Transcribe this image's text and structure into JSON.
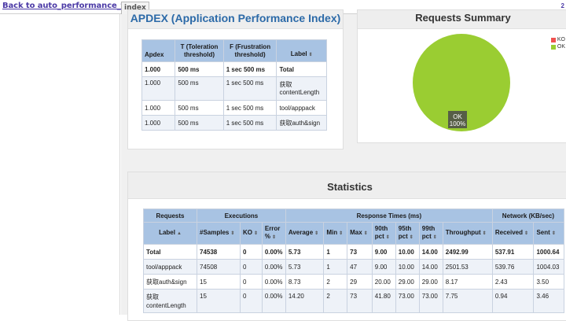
{
  "topbar": {
    "back_link": "Back to auto_performance_test",
    "tab": "index",
    "corner": "2"
  },
  "apdex": {
    "title": "APDEX (Application Performance Index)",
    "headers": [
      "Apdex",
      "T (Toleration threshold)",
      "F (Frustration threshold)",
      "Label"
    ],
    "rows": [
      [
        "1.000",
        "500 ms",
        "1 sec 500 ms",
        "Total"
      ],
      [
        "1.000",
        "500 ms",
        "1 sec 500 ms",
        "获取contentLength"
      ],
      [
        "1.000",
        "500 ms",
        "1 sec 500 ms",
        "tool/apppack"
      ],
      [
        "1.000",
        "500 ms",
        "1 sec 500 ms",
        "获取auth&sign"
      ]
    ]
  },
  "summary": {
    "title": "Requests Summary",
    "legend": [
      {
        "label": "KO",
        "color": "#f0524f"
      },
      {
        "label": "OK",
        "color": "#9acd32"
      }
    ],
    "slice_label": "OK",
    "slice_pct": "100%"
  },
  "chart_data": {
    "type": "pie",
    "categories": [
      "KO",
      "OK"
    ],
    "values": [
      0,
      100
    ],
    "title": "Requests Summary"
  },
  "stats": {
    "title": "Statistics",
    "groups": [
      "Requests",
      "Executions",
      "Response Times (ms)",
      "Network (KB/sec)"
    ],
    "headers": [
      "Label",
      "#Samples",
      "KO",
      "Error %",
      "Average",
      "Min",
      "Max",
      "90th pct",
      "95th pct",
      "99th pct",
      "Throughput",
      "Received",
      "Sent"
    ],
    "rows": [
      [
        "Total",
        "74538",
        "0",
        "0.00%",
        "5.73",
        "1",
        "73",
        "9.00",
        "10.00",
        "14.00",
        "2492.99",
        "537.91",
        "1000.64"
      ],
      [
        "tool/apppack",
        "74508",
        "0",
        "0.00%",
        "5.73",
        "1",
        "47",
        "9.00",
        "10.00",
        "14.00",
        "2501.53",
        "539.76",
        "1004.03"
      ],
      [
        "获取auth&sign",
        "15",
        "0",
        "0.00%",
        "8.73",
        "2",
        "29",
        "20.00",
        "29.00",
        "29.00",
        "8.17",
        "2.43",
        "3.50"
      ],
      [
        "获取contentLength",
        "15",
        "0",
        "0.00%",
        "14.20",
        "2",
        "73",
        "41.80",
        "73.00",
        "73.00",
        "7.75",
        "0.94",
        "3.46"
      ]
    ]
  },
  "colors": {
    "header_bg": "#a8c3e3",
    "apdex_title": "#2c6aa8",
    "ok": "#9acd32",
    "ko": "#f0524f",
    "link": "#4b3aa6"
  }
}
